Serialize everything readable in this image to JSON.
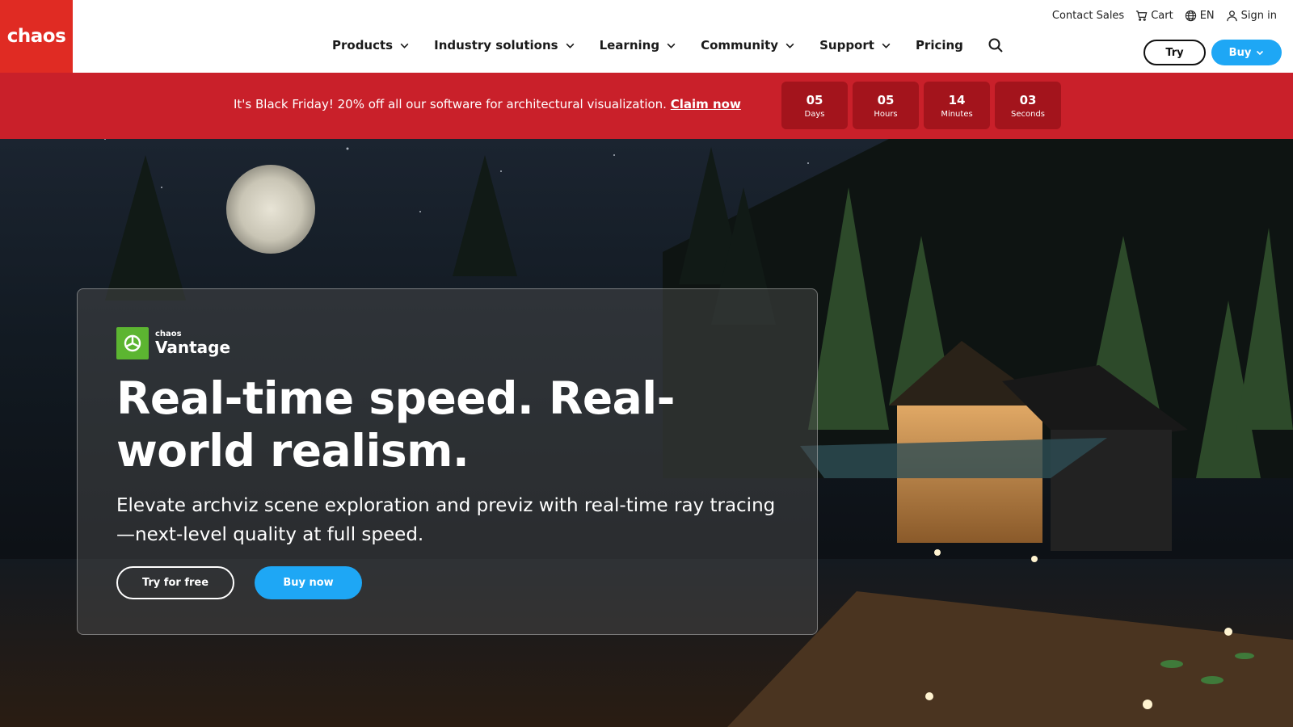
{
  "brand": {
    "logo_text": "chaos",
    "logo_color": "#e02b23"
  },
  "utility_nav": {
    "contact_sales": "Contact Sales",
    "cart": "Cart",
    "language": "EN",
    "sign_in": "Sign in"
  },
  "main_nav": {
    "items": [
      {
        "label": "Products",
        "has_dropdown": true
      },
      {
        "label": "Industry solutions",
        "has_dropdown": true
      },
      {
        "label": "Learning",
        "has_dropdown": true
      },
      {
        "label": "Community",
        "has_dropdown": true
      },
      {
        "label": "Support",
        "has_dropdown": true
      },
      {
        "label": "Pricing",
        "has_dropdown": false
      }
    ],
    "search_icon": "search-icon"
  },
  "header_actions": {
    "try_label": "Try",
    "buy_label": "Buy",
    "accent": "#1ea7f5"
  },
  "promo": {
    "text": "It's Black Friday! 20% off all our software for architectural visualization.",
    "link": "Claim now",
    "background": "#c9202a",
    "countdown": [
      {
        "value": "05",
        "label": "Days"
      },
      {
        "value": "05",
        "label": "Hours"
      },
      {
        "value": "14",
        "label": "Minutes"
      },
      {
        "value": "03",
        "label": "Seconds"
      }
    ]
  },
  "hero": {
    "product_brand": "chaos",
    "product_name": "Vantage",
    "product_color": "#5cb531",
    "title": "Real-time speed. Real-world realism.",
    "subtitle": "Elevate archviz scene exploration and previz with real-time ray tracing—next-level quality at full speed.",
    "try_label": "Try for free",
    "buy_label": "Buy now"
  }
}
